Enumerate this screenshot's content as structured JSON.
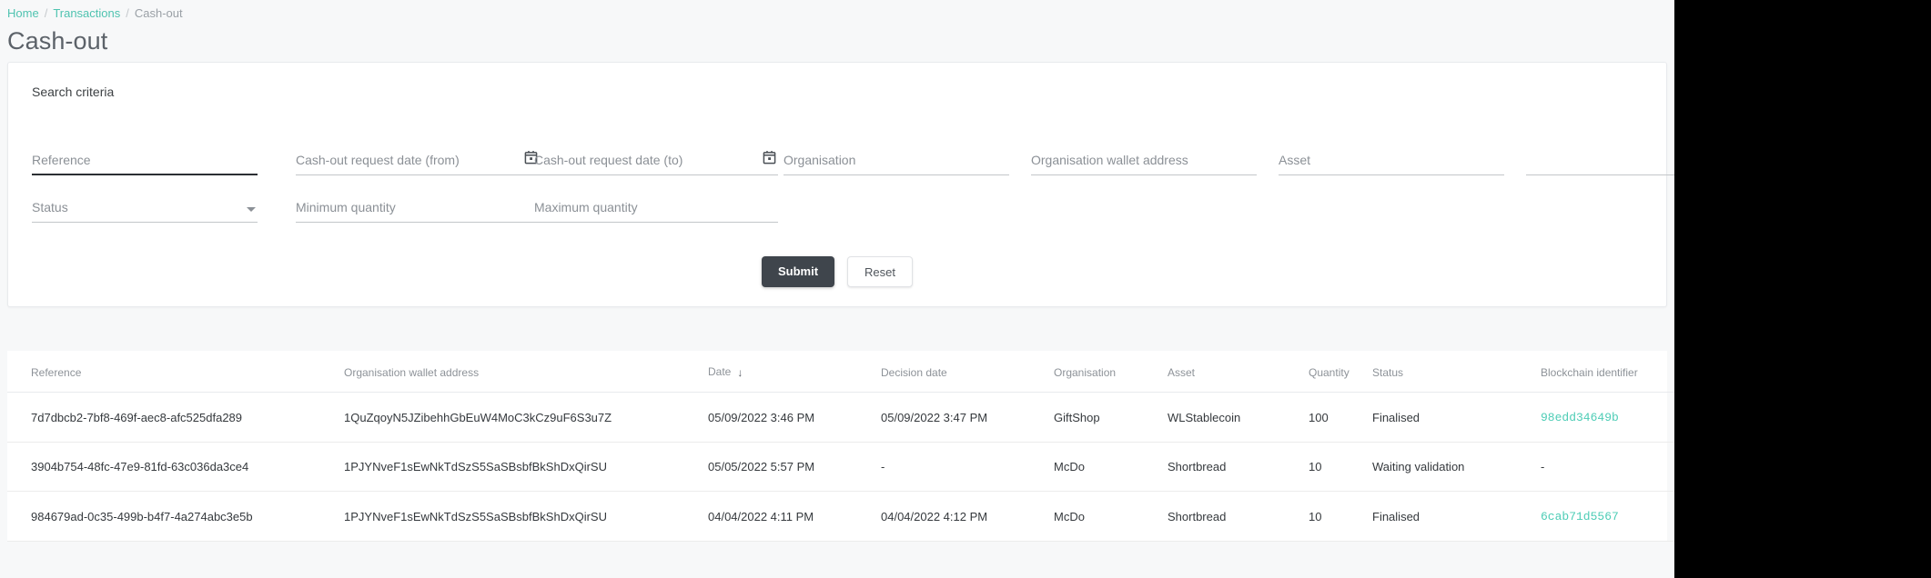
{
  "breadcrumb": {
    "items": [
      {
        "label": "Home",
        "type": "link"
      },
      {
        "label": "Transactions",
        "type": "link"
      },
      {
        "label": "Cash-out",
        "type": "current"
      }
    ],
    "separator": "/"
  },
  "page": {
    "title": "Cash-out"
  },
  "search_card": {
    "title": "Search criteria",
    "fields": [
      {
        "name": "reference",
        "label": "Reference",
        "value": "",
        "focused": true,
        "icon": "none"
      },
      {
        "name": "date_from",
        "label": "Cash-out request date (from)",
        "value": "",
        "focused": false,
        "icon": "calendar-icon"
      },
      {
        "name": "date_to",
        "label": "Cash-out request date (to)",
        "value": "",
        "focused": false,
        "icon": "calendar-icon"
      },
      {
        "name": "organisation",
        "label": "Organisation",
        "value": "",
        "focused": false,
        "icon": "none"
      },
      {
        "name": "wallet_address",
        "label": "Organisation wallet address",
        "value": "",
        "focused": false,
        "icon": "none"
      },
      {
        "name": "asset",
        "label": "Asset",
        "value": "",
        "focused": false,
        "icon": "none"
      },
      {
        "name": "status",
        "label": "Status",
        "value": "",
        "focused": false,
        "icon": "chevron-down-icon"
      },
      {
        "name": "min_quantity",
        "label": "Minimum quantity",
        "value": "",
        "focused": false,
        "icon": "none"
      },
      {
        "name": "max_quantity",
        "label": "Maximum quantity",
        "value": "",
        "focused": false,
        "icon": "none"
      }
    ],
    "submit_label": "Submit",
    "reset_label": "Reset"
  },
  "table": {
    "columns": [
      "Reference",
      "Organisation wallet address",
      "Date",
      "Decision date",
      "Organisation",
      "Asset",
      "Quantity",
      "Status",
      "Blockchain identifier"
    ],
    "sort": {
      "column": "Date",
      "direction": "desc",
      "glyph": "↓"
    },
    "rows": [
      {
        "reference": "7d7dbcb2-7bf8-469f-aec8-afc525dfa289",
        "wallet": "1QuZqoyN5JZibehhGbEuW4MoC3kCz9uF6S3u7Z",
        "date": "05/09/2022 3:46 PM",
        "decision_date": "05/09/2022 3:47 PM",
        "organisation": "GiftShop",
        "asset": "WLStablecoin",
        "quantity": "100",
        "status": "Finalised",
        "blockchain_identifier": "98edd34649b"
      },
      {
        "reference": "3904b754-48fc-47e9-81fd-63c036da3ce4",
        "wallet": "1PJYNveF1sEwNkTdSzS5SaSBsbfBkShDxQirSU",
        "date": "05/05/2022 5:57 PM",
        "decision_date": "-",
        "organisation": "McDo",
        "asset": "Shortbread",
        "quantity": "10",
        "status": "Waiting validation",
        "blockchain_identifier": "-"
      },
      {
        "reference": "984679ad-0c35-499b-b4f7-4a274abc3e5b",
        "wallet": "1PJYNveF1sEwNkTdSzS5SaSBsbfBkShDxQirSU",
        "date": "04/04/2022 4:11 PM",
        "decision_date": "04/04/2022 4:12 PM",
        "organisation": "McDo",
        "asset": "Shortbread",
        "quantity": "10",
        "status": "Finalised",
        "blockchain_identifier": "6cab71d5567"
      }
    ]
  },
  "colors": {
    "accent_teal": "#4ecdb6",
    "primary_button": "#3f454c",
    "page_background": "#f7f8f9",
    "text_muted": "#8d9298"
  }
}
